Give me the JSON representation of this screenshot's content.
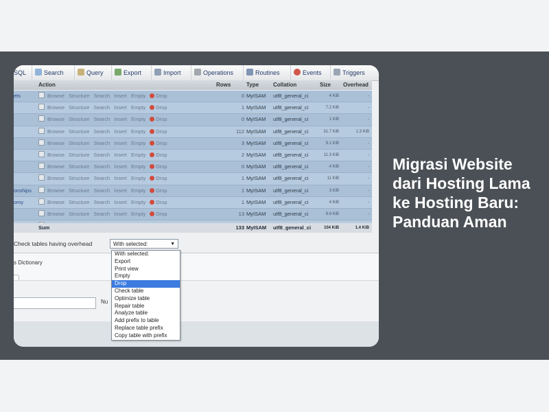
{
  "heading": "Migrasi Website dari Hosting Lama ke Hosting Baru: Panduan Aman",
  "tabs": [
    {
      "label": "SQL",
      "icon": "sql-icon"
    },
    {
      "label": "Search",
      "icon": "search-icon"
    },
    {
      "label": "Query",
      "icon": "query-icon"
    },
    {
      "label": "Export",
      "icon": "export-icon"
    },
    {
      "label": "Import",
      "icon": "import-icon"
    },
    {
      "label": "Operations",
      "icon": "wrench-icon"
    },
    {
      "label": "Routines",
      "icon": "routines-icon"
    },
    {
      "label": "Events",
      "icon": "clock-icon"
    },
    {
      "label": "Triggers",
      "icon": "triggers-icon"
    }
  ],
  "columns": {
    "action": "Action",
    "rows": "Rows",
    "type": "Type",
    "collation": "Collation",
    "size": "Size",
    "overhead": "Overhead"
  },
  "actions": {
    "browse": "Browse",
    "structure": "Structure",
    "search": "Search",
    "insert": "Insert",
    "empty": "Empty",
    "drop": "Drop"
  },
  "table_rows": [
    {
      "name": "ets",
      "rows": "0",
      "type": "MyISAM",
      "collation": "utf8_general_ci",
      "size": "4 KiB",
      "overhead": "-"
    },
    {
      "name": "",
      "rows": "1",
      "type": "MyISAM",
      "collation": "utf8_general_ci",
      "size": "7.2 KiB",
      "overhead": "-"
    },
    {
      "name": "",
      "rows": "0",
      "type": "MyISAM",
      "collation": "utf8_general_ci",
      "size": "1 KiB",
      "overhead": "-"
    },
    {
      "name": "",
      "rows": "112",
      "type": "MyISAM",
      "collation": "utf8_general_ci",
      "size": "31.7 KiB",
      "overhead": "1.3 KiB"
    },
    {
      "name": "",
      "rows": "3",
      "type": "MyISAM",
      "collation": "utf8_general_ci",
      "size": "9.1 KiB",
      "overhead": "-"
    },
    {
      "name": "",
      "rows": "2",
      "type": "MyISAM",
      "collation": "utf8_general_ci",
      "size": "11.3 KiB",
      "overhead": "-"
    },
    {
      "name": "",
      "rows": "0",
      "type": "MyISAM",
      "collation": "utf8_general_ci",
      "size": "4 KiB",
      "overhead": "-"
    },
    {
      "name": "",
      "rows": "1",
      "type": "MyISAM",
      "collation": "utf8_general_ci",
      "size": "11 KiB",
      "overhead": "-"
    },
    {
      "name": "onships",
      "rows": "1",
      "type": "MyISAM",
      "collation": "utf8_general_ci",
      "size": "3 KiB",
      "overhead": "-"
    },
    {
      "name": "omy",
      "rows": "1",
      "type": "MyISAM",
      "collation": "utf8_general_ci",
      "size": "4 KiB",
      "overhead": "-"
    },
    {
      "name": "",
      "rows": "13",
      "type": "MyISAM",
      "collation": "utf8_general_ci",
      "size": "9.6 KiB",
      "overhead": "-"
    },
    {
      "name": "",
      "rows": "1",
      "type": "MyISAM",
      "collation": "utf8_general_ci",
      "size": "7.1 KiB",
      "overhead": "-"
    }
  ],
  "sum": {
    "label": "Sum",
    "rows": "133",
    "type": "MyISAM",
    "collation": "utf8_general_ci",
    "size": "104 KiB",
    "overhead": "1.4 KiB"
  },
  "controls": {
    "check_overhead": "Check tables having overhead",
    "select_value": "With selected:",
    "data_dictionary": "s Dictionary",
    "number_label": "Nu"
  },
  "menu_options": [
    "With selected:",
    "Export",
    "Print view",
    "Empty",
    "Drop",
    "Check table",
    "Optimize table",
    "Repair table",
    "Analyze table",
    "Add prefix to table",
    "Replace table prefix",
    "Copy table with prefix"
  ],
  "menu_highlighted": "Drop"
}
